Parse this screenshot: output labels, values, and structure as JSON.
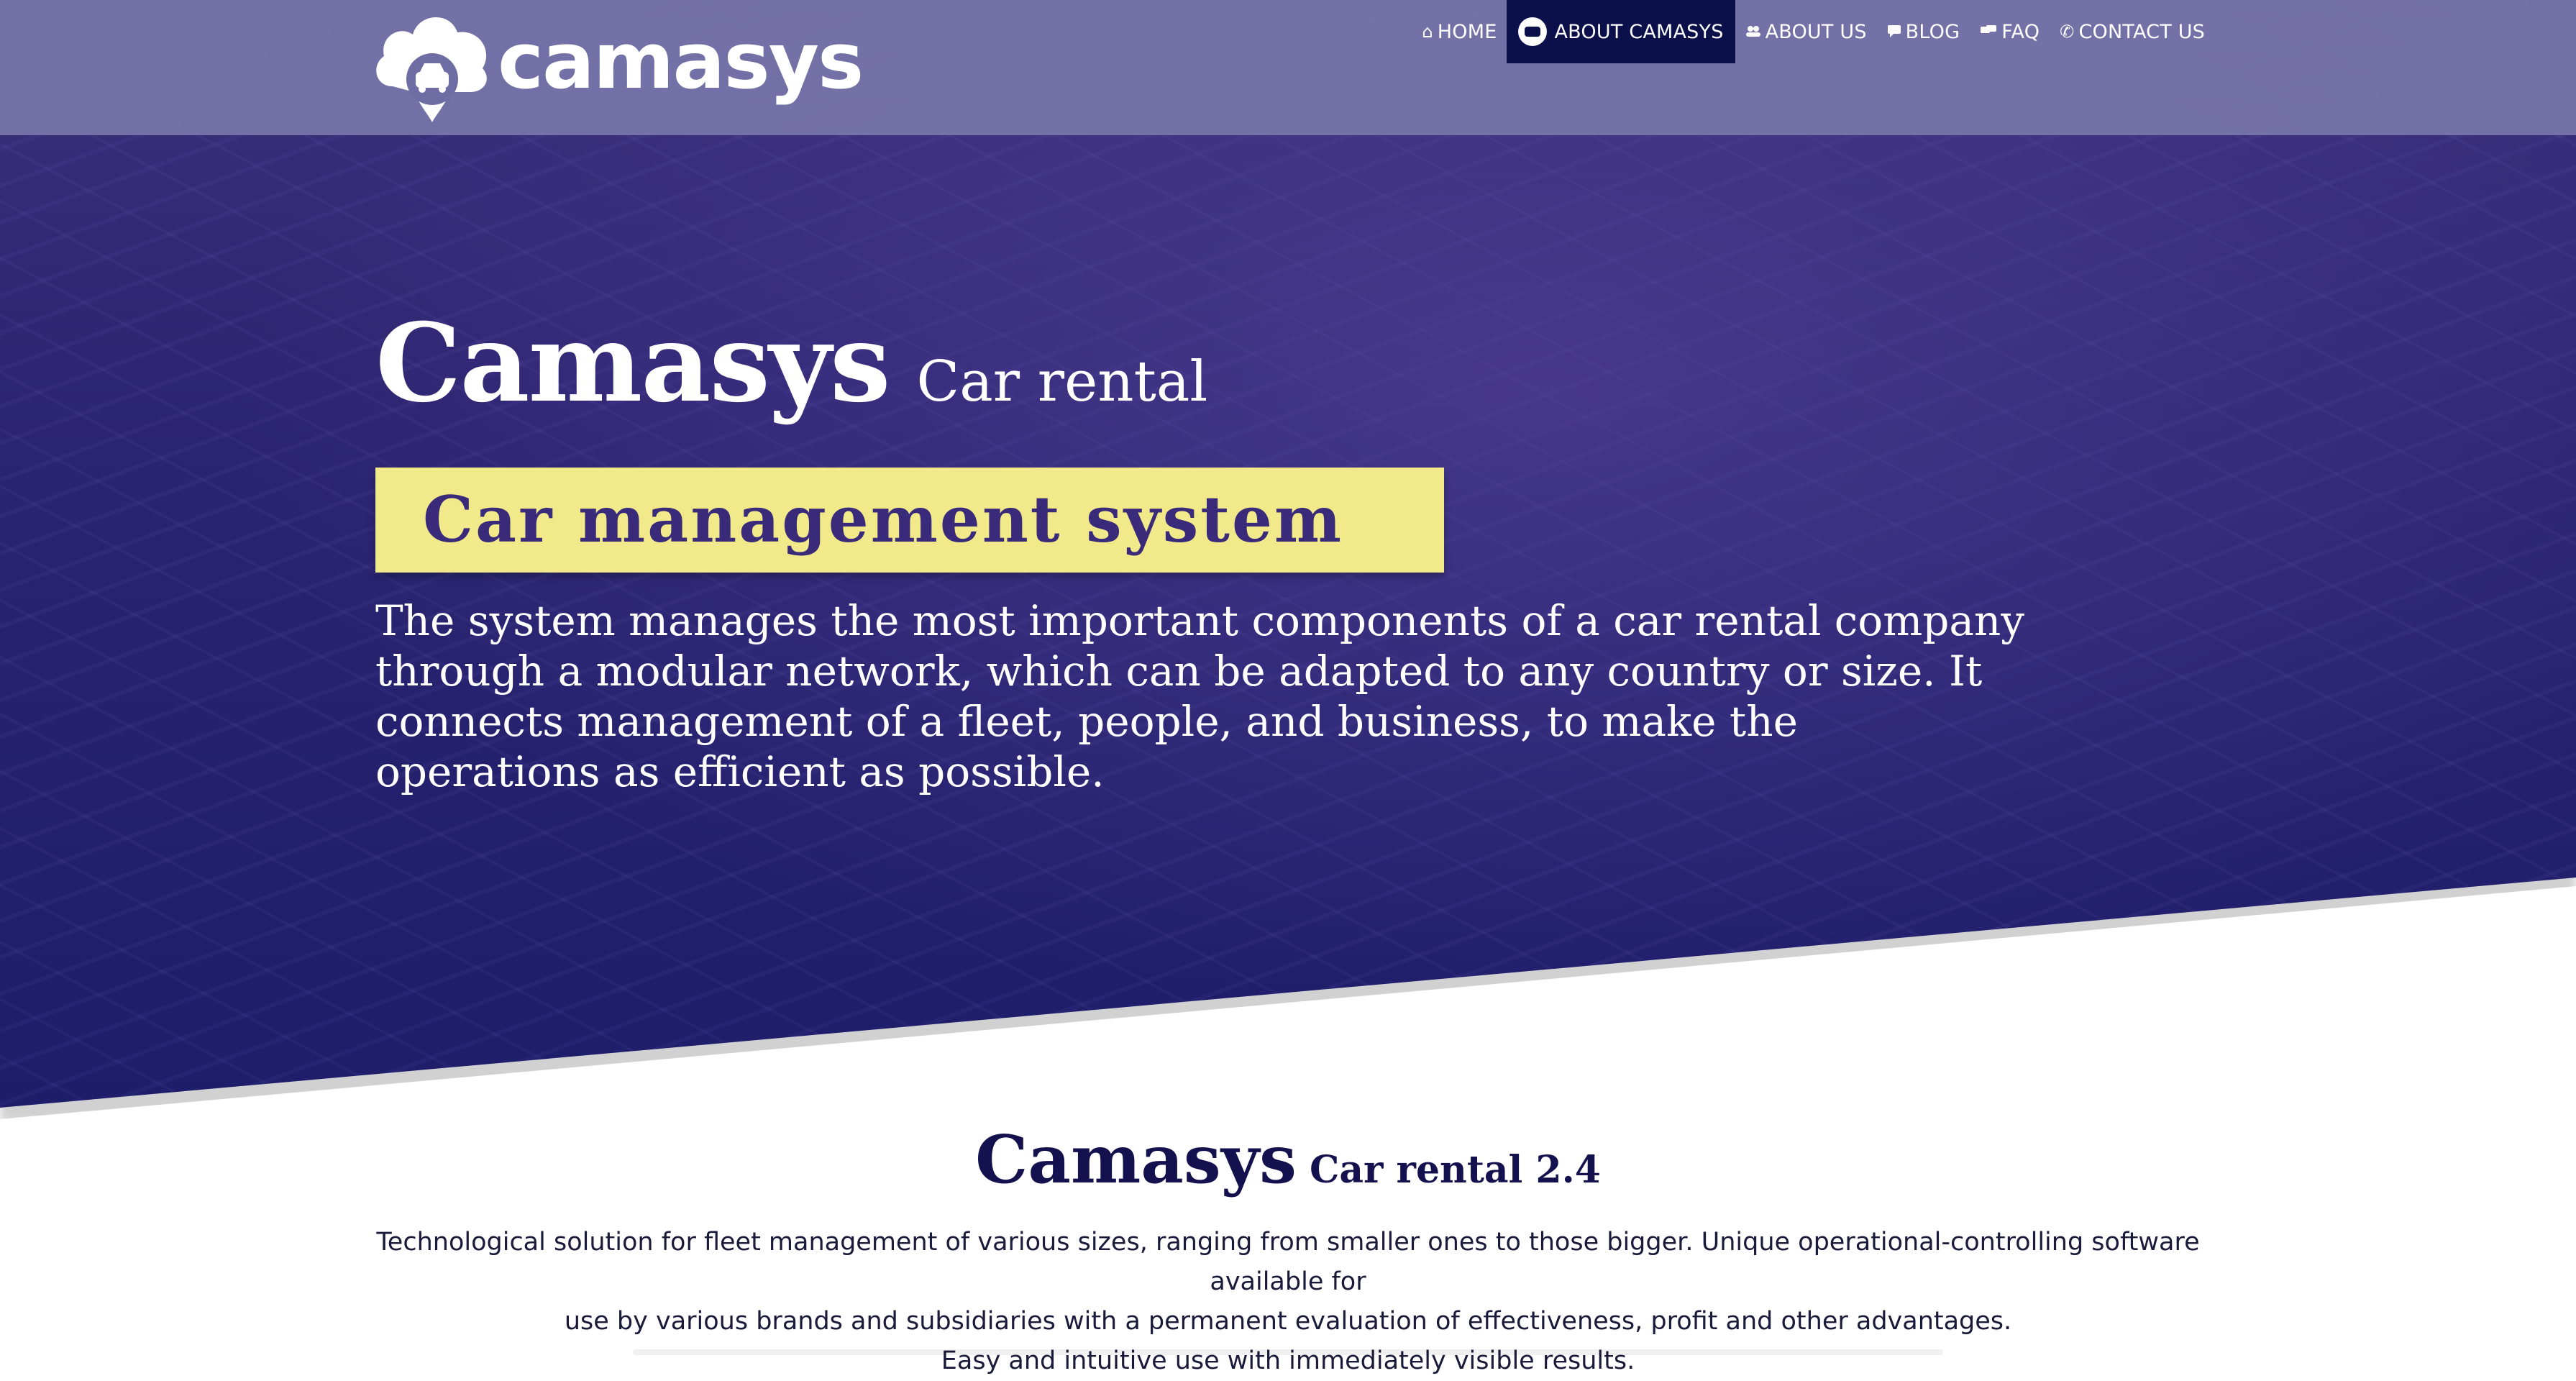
{
  "header": {
    "logo_text": "camasys",
    "nav": [
      {
        "label": "HOME",
        "icon": "home-icon",
        "glyph": "⌂"
      },
      {
        "label": "ABOUT CAMASYS",
        "icon": "camasys-car-icon",
        "glyph": ""
      },
      {
        "label": "ABOUT US",
        "icon": "users-icon",
        "glyph": "👥"
      },
      {
        "label": "BLOG",
        "icon": "comment-icon",
        "glyph": "▪"
      },
      {
        "label": "FAQ",
        "icon": "comments-icon",
        "glyph": "▪"
      },
      {
        "label": "CONTACT US",
        "icon": "phone-icon",
        "glyph": "✆"
      }
    ],
    "active_nav": "ABOUT CAMASYS"
  },
  "hero": {
    "title": "Camasys",
    "subtitle": "Car rental",
    "tagline": "Car management system",
    "description": "The system manages the most important components of a car rental company through a modular network, which can be adapted to any country or size. It connects management of a fleet, people, and business, to make the operations as efficient as possible."
  },
  "section": {
    "title": "Camasys",
    "subtitle": "Car rental 2.4",
    "lines": [
      "Technological solution for fleet management of various sizes, ranging from smaller ones to those bigger. Unique operational-controlling software available for",
      "use by various brands and subsidiaries with a permanent evaluation of effectiveness, profit and other advantages.",
      "Easy and intuitive use with immediately visible results."
    ]
  },
  "colors": {
    "header_bg": "#7876aa",
    "active_nav_bg": "#0b0f4a",
    "hero_bg": "#2b2470",
    "tagline_bg": "#f1e98a",
    "tagline_text": "#3a2a7a",
    "section_title": "#15114f"
  }
}
